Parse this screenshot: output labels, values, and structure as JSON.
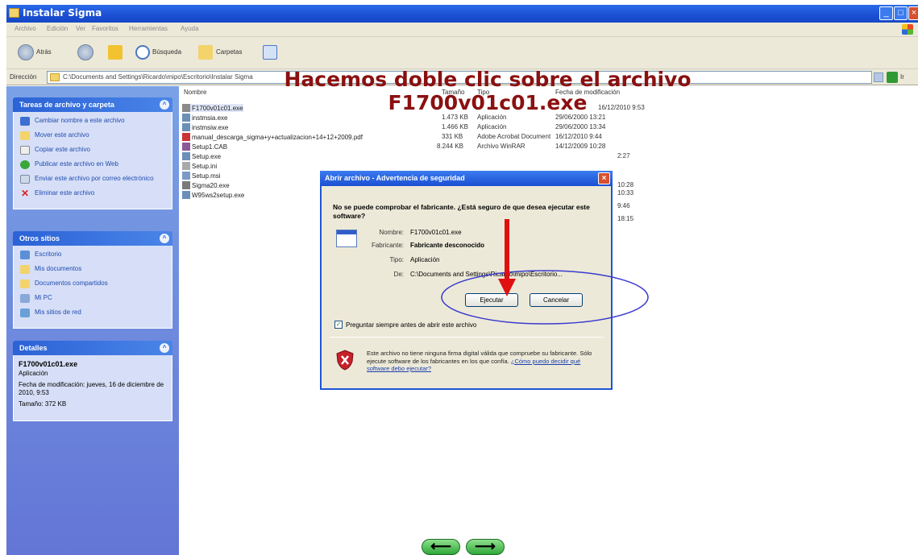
{
  "window": {
    "title": "Instalar Sigma"
  },
  "menu": [
    "Archivo",
    "Edición",
    "Ver",
    "Favoritos",
    "Herramientas",
    "Ayuda"
  ],
  "toolbar": {
    "back_label": "Atrás",
    "search_label": "Búsqueda",
    "folders_label": "Carpetas"
  },
  "address": {
    "label": "Dirección",
    "value": "C:\\Documents and Settings\\Ricardo\\mipo\\Escritorio\\Instalar Sigma",
    "go_label": "Ir"
  },
  "heading": {
    "line1": "Hacemos doble clic sobre el archivo",
    "line2": "F1700v01c01.exe"
  },
  "tasks_panel": {
    "title": "Tareas de archivo y carpeta",
    "items": [
      "Cambiar nombre a este archivo",
      "Mover este archivo",
      "Copiar este archivo",
      "Publicar este archivo en Web",
      "Enviar este archivo por correo electrónico",
      "Eliminar este archivo"
    ]
  },
  "places_panel": {
    "title": "Otros sitios",
    "items": [
      "Escritorio",
      "Mis documentos",
      "Documentos compartidos",
      "Mi PC",
      "Mis sitios de red"
    ]
  },
  "details_panel": {
    "title": "Detalles",
    "file": "F1700v01c01.exe",
    "type": "Aplicación",
    "modified": "Fecha de modificación: jueves, 16 de diciembre de 2010, 9:53",
    "size": "Tamaño: 372 KB"
  },
  "filelist": {
    "headers": {
      "name": "Nombre",
      "size": "Tamaño",
      "type": "Tipo",
      "date": "Fecha de modificación"
    },
    "files": [
      {
        "name": "F1700v01c01.exe",
        "size": "",
        "type": "",
        "date": "16/12/2010 9:53"
      },
      {
        "name": "instmsia.exe",
        "size": "1.473 KB",
        "type": "Aplicación",
        "date": "29/06/2000 13:21"
      },
      {
        "name": "instmsiw.exe",
        "size": "1.466 KB",
        "type": "Aplicación",
        "date": "29/06/2000 13:34"
      },
      {
        "name": "manual_descarga_sigma+y+actualizacion+14+12+2009.pdf",
        "size": "331 KB",
        "type": "Adobe Acrobat Document",
        "date": "16/12/2010 9:44"
      },
      {
        "name": "Setup1.CAB",
        "size": "8.244 KB",
        "type": "Archivo WinRAR",
        "date": "14/12/2009 10:28"
      },
      {
        "name": "Setup.exe",
        "size": "",
        "type": "",
        "date": "2:27"
      },
      {
        "name": "Setup.ini",
        "size": "",
        "type": "",
        "date": "10:28"
      },
      {
        "name": "Setup.msi",
        "size": "",
        "type": "",
        "date": "10:33"
      },
      {
        "name": "Sigma20.exe",
        "size": "",
        "type": "",
        "date": "9:46"
      },
      {
        "name": "W95ws2setup.exe",
        "size": "",
        "type": "",
        "date": "18:15"
      }
    ]
  },
  "dialog": {
    "title": "Abrir archivo - Advertencia de seguridad",
    "question": "No se puede comprobar el fabricante. ¿Está seguro de que desea ejecutar este software?",
    "name_label": "Nombre:",
    "name_value": "F1700v01c01.exe",
    "publisher_label": "Fabricante:",
    "publisher_value": "Fabricante desconocido",
    "type_label": "Tipo:",
    "type_value": "Aplicación",
    "from_label": "De:",
    "from_value": "C:\\Documents and Settings\\Ricardo\\mipo\\Escritorio...",
    "run_button": "Ejecutar",
    "cancel_button": "Cancelar",
    "checkbox_label": "Preguntar siempre antes de abrir este archivo",
    "warning_text": "Este archivo no tiene ninguna firma digital válida que compruebe su fabricante. Sólo ejecute software de los fabricantes en los que confía.",
    "warning_link": "¿Cómo puedo decidir qué software debo ejecutar?"
  },
  "nav": {
    "prev": "⟵",
    "next": "⟶"
  },
  "colors": {
    "heading": "#8b1010",
    "xp_blue": "#1f55d6",
    "annotation_arrow": "#e01010",
    "annotation_ellipse": "#3a3ad0"
  }
}
